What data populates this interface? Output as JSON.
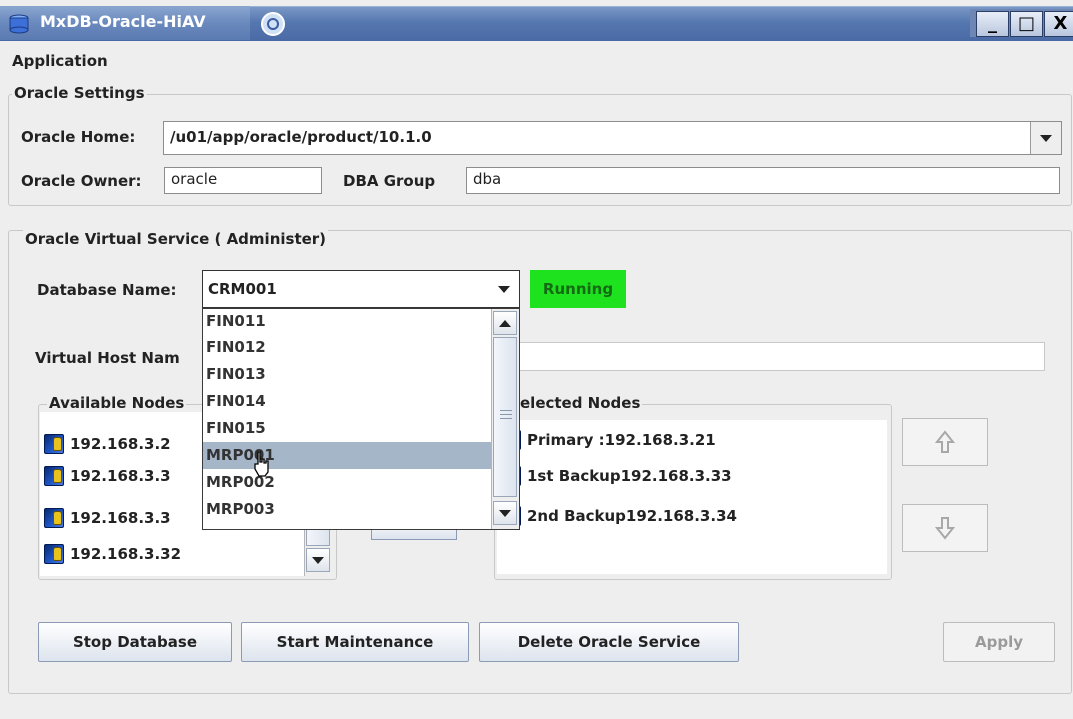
{
  "window": {
    "title": "MxDB-Oracle-HiAV",
    "min_glyph": "_",
    "max_glyph": "□",
    "close_glyph": "X"
  },
  "menu": {
    "items": [
      "Application"
    ]
  },
  "oracle_settings": {
    "legend": "Oracle Settings",
    "home_label": "Oracle Home:",
    "home_value": "/u01/app/oracle/product/10.1.0",
    "owner_label": "Oracle Owner:",
    "owner_value": "oracle",
    "dba_label": "DBA Group",
    "dba_value": "dba"
  },
  "virtual_service": {
    "legend": "Oracle Virtual Service ( Administer)",
    "db_label": "Database Name:",
    "db_value": "CRM001",
    "status": "Running",
    "status_color": "#1ee21e",
    "host_label": "Virtual Host Nam",
    "available_legend": "Available Nodes",
    "available_nodes": [
      "192.168.3.2",
      "192.168.3.3",
      "192.168.3.3",
      "192.168.3.32"
    ],
    "selected_legend": "elected Nodes",
    "selected_nodes": [
      "Primary :192.168.3.21",
      "1st Backup192.168.3.33",
      "2nd Backup192.168.3.34"
    ]
  },
  "dropdown": {
    "items": [
      "FIN011",
      "FIN012",
      "FIN013",
      "FIN014",
      "FIN015",
      "MRP001",
      "MRP002",
      "MRP003"
    ],
    "selected": "MRP001"
  },
  "buttons": {
    "stop": "Stop Database",
    "maintenance": "Start Maintenance",
    "delete": "Delete Oracle Service",
    "apply": "Apply"
  },
  "icons": {
    "app": "database-icon",
    "node": "server-node-icon",
    "move_up": "arrow-up-icon",
    "move_down": "arrow-down-icon"
  }
}
